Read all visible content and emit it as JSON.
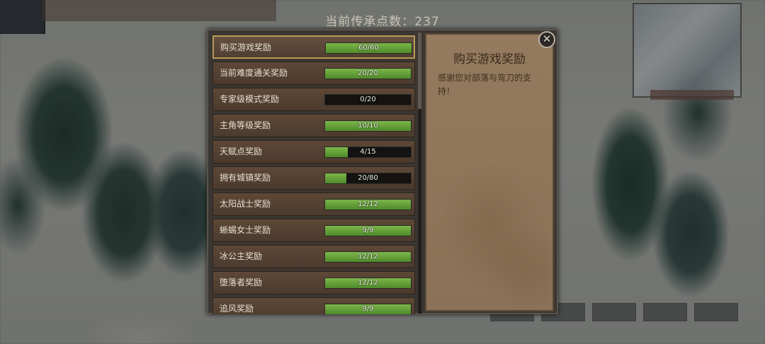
{
  "header": {
    "legacy_points": "当前传承点数：237"
  },
  "rewards": [
    {
      "label": "购买游戏奖励",
      "progress": "60/60",
      "fraction": 1.0,
      "selected": true
    },
    {
      "label": "当前难度通关奖励",
      "progress": "20/20",
      "fraction": 1.0
    },
    {
      "label": "专家级模式奖励",
      "progress": "0/20",
      "fraction": 0.0
    },
    {
      "label": "主角等级奖励",
      "progress": "10/10",
      "fraction": 1.0
    },
    {
      "label": "天赋点奖励",
      "progress": "4/15",
      "fraction": 0.267
    },
    {
      "label": "拥有城镇奖励",
      "progress": "20/80",
      "fraction": 0.25
    },
    {
      "label": "太阳战士奖励",
      "progress": "12/12",
      "fraction": 1.0
    },
    {
      "label": "蜥蜴女士奖励",
      "progress": "9/9",
      "fraction": 1.0
    },
    {
      "label": "冰公主奖励",
      "progress": "12/12",
      "fraction": 1.0
    },
    {
      "label": "堕落者奖励",
      "progress": "12/12",
      "fraction": 1.0
    },
    {
      "label": "追风奖励",
      "progress": "9/9",
      "fraction": 1.0
    }
  ],
  "detail": {
    "title": "购买游戏奖励",
    "description": "感谢您对部落与弯刀的支持！"
  },
  "close_icon": "close-icon",
  "colors": {
    "bar_fill": "#6aa23c",
    "selected_border": "#b79a55"
  }
}
